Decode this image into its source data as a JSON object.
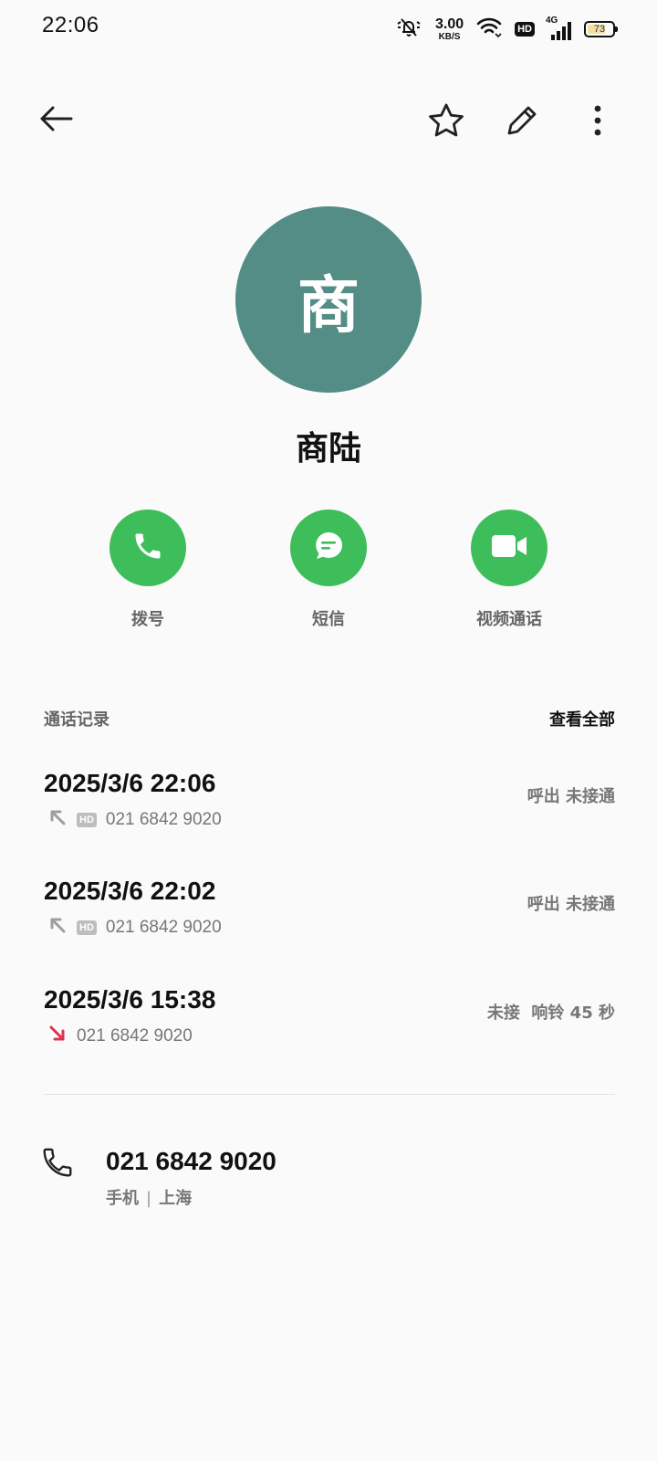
{
  "status_bar": {
    "time": "22:06",
    "net_speed_value": "3.00",
    "net_speed_unit": "KB/S",
    "hd_label": "HD",
    "network_type": "4G",
    "battery_level": "73",
    "battery_fraction": 0.73
  },
  "toolbar": {
    "back_icon": "back-arrow-icon",
    "favorite_icon": "star-outline-icon",
    "edit_icon": "pencil-icon",
    "more_icon": "more-vertical-icon"
  },
  "contact": {
    "avatar_initial": "商",
    "avatar_color": "#538d85",
    "name": "商陆"
  },
  "actions": [
    {
      "label": "拨号",
      "icon": "phone-icon"
    },
    {
      "label": "短信",
      "icon": "message-icon"
    },
    {
      "label": "视频通话",
      "icon": "video-icon"
    }
  ],
  "call_log": {
    "title": "通话记录",
    "view_all": "查看全部",
    "entries": [
      {
        "datetime": "2025/3/6 22:06",
        "direction": "outgoing",
        "hd": "HD",
        "number": "021 6842 9020",
        "status": "呼出 未接通"
      },
      {
        "datetime": "2025/3/6 22:02",
        "direction": "outgoing",
        "hd": "HD",
        "number": "021 6842 9020",
        "status": "呼出 未接通"
      },
      {
        "datetime": "2025/3/6 15:38",
        "direction": "missed",
        "hd": "",
        "number": "021 6842 9020",
        "status": "未接  响铃 45 秒"
      }
    ]
  },
  "phone": {
    "number": "021 6842 9020",
    "type": "手机",
    "separator": "|",
    "location": "上海"
  },
  "colors": {
    "accent_green": "#3dbe5a",
    "missed_red": "#d9344a",
    "outgoing_gray": "#9e9e9e"
  }
}
